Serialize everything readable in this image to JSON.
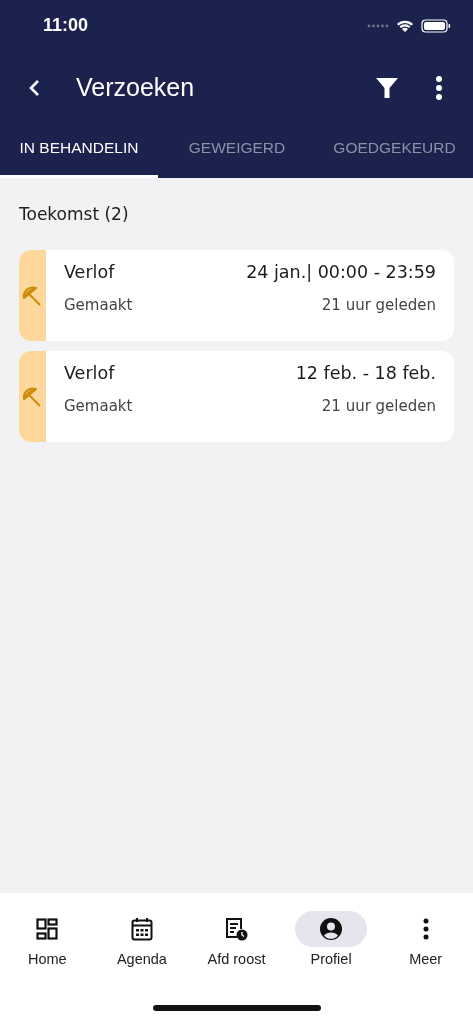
{
  "status_bar": {
    "time": "11:00"
  },
  "header": {
    "title": "Verzoeken"
  },
  "tabs": [
    {
      "label": "IN BEHANDELIN",
      "selected": true
    },
    {
      "label": "GEWEIGERD",
      "selected": false
    },
    {
      "label": "GOEDGEKEURD",
      "selected": false
    }
  ],
  "section": {
    "title": "Toekomst (2)"
  },
  "requests": [
    {
      "type": "Verlof",
      "date": "24 jan.| 00:00 - 23:59",
      "status": "Gemaakt",
      "time": "21 uur geleden"
    },
    {
      "type": "Verlof",
      "date": "12 feb. - 18 feb.",
      "status": "Gemaakt",
      "time": "21 uur geleden"
    }
  ],
  "bottom_nav": [
    {
      "kind": "home",
      "label": "Home",
      "selected": false
    },
    {
      "kind": "calendar",
      "label": "Agenda",
      "selected": false
    },
    {
      "kind": "schedule",
      "label": "Afd roost",
      "selected": false
    },
    {
      "kind": "profile",
      "label": "Profiel",
      "selected": true
    },
    {
      "kind": "more",
      "label": "Meer",
      "selected": false
    }
  ]
}
